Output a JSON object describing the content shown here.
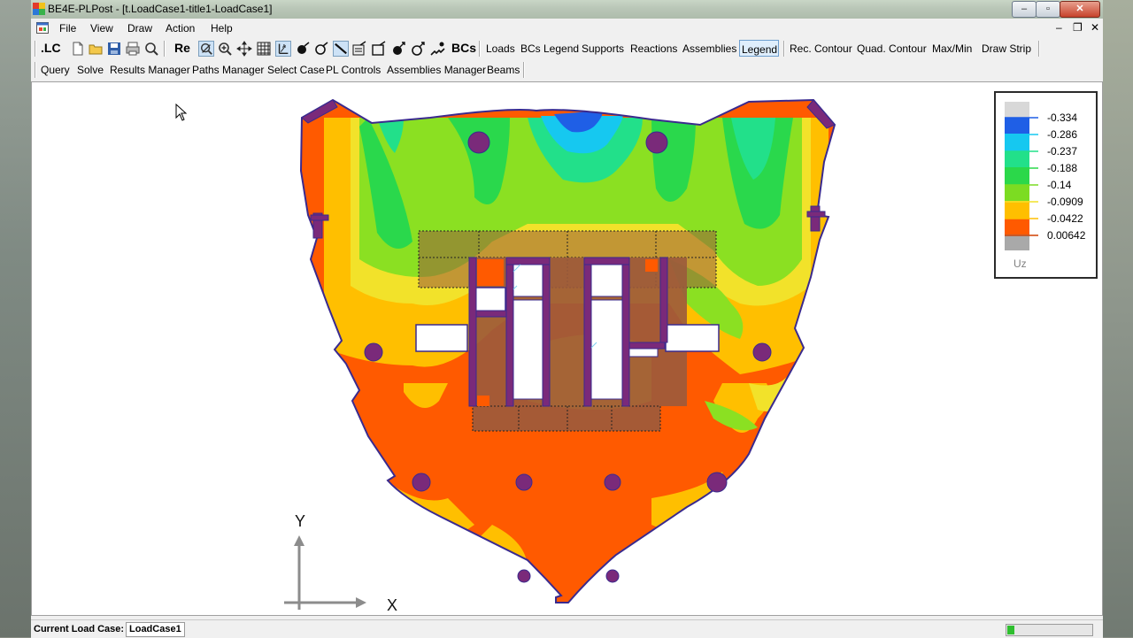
{
  "window": {
    "title": "BE4E-PLPost - [t.LoadCase1-title1-LoadCase1]",
    "controls": {
      "minimize": "–",
      "maximize": "▫",
      "close": "✕"
    }
  },
  "menubar": {
    "items": [
      "File",
      "View",
      "Draw",
      "Action",
      "Help"
    ],
    "mdi_controls": {
      "minimize": "–",
      "restore": "❐",
      "close": "✕"
    }
  },
  "toolbar1": {
    "lc_label": ".LC",
    "re_label": "Re",
    "bcs_label": "BCs",
    "icons": [
      "new-file-icon",
      "open-folder-icon",
      "save-icon",
      "print-icon",
      "zoom-preview-icon",
      "zoom-window-icon",
      "zoom-in-icon",
      "pan-icon",
      "mesh-grid-icon",
      "axes-icon",
      "node-point-icon",
      "node-ring-icon",
      "line-tool-icon",
      "frame-tool-icon",
      "rect-tool-icon",
      "load-point-icon",
      "load-ring-icon",
      "support-spring-icon"
    ],
    "text_buttons": [
      "Loads",
      "BCs Legend",
      "Supports",
      "Reactions",
      "Assemblies"
    ],
    "legend_label": "Legend",
    "right_buttons": [
      "Rec. Contour",
      "Quad. Contour",
      "Max/Min",
      "Draw Strip"
    ]
  },
  "toolbar2": {
    "items": [
      "Query",
      "Solve",
      "Results Manager",
      "Paths Manager",
      "Select Case",
      "PL Controls",
      "Assemblies Manager",
      "Beams"
    ]
  },
  "legend": {
    "entries": [
      {
        "value": "-0.334",
        "color": "#1f5fe6"
      },
      {
        "value": "-0.286",
        "color": "#16c8f0"
      },
      {
        "value": "-0.237",
        "color": "#22e08a"
      },
      {
        "value": "-0.188",
        "color": "#2bd84a"
      },
      {
        "value": "-0.14",
        "color": "#7cdc22"
      },
      {
        "value": "-0.0909",
        "color": "#f2e22a"
      },
      {
        "value": "-0.0422",
        "color": "#ffbf00"
      },
      {
        "value": "0.00642",
        "color": "#ff5a00"
      }
    ],
    "top_color": "#d8d8d8",
    "bottom_color": "#a9a9a9",
    "unit": "Uz"
  },
  "axes": {
    "x_label": "X",
    "y_label": "Y"
  },
  "status": {
    "label": "Current Load Case:",
    "value": "LoadCase1",
    "progress": 0.08
  },
  "colors": {
    "outline": "#3a2a8e",
    "column_fill": "#7a2a7a",
    "core_overlay": "#9b5a3c",
    "orange": "#ff5a00",
    "amber": "#ffbf00",
    "yellow": "#f2e22a",
    "lime": "#8be022",
    "green": "#2ad84c",
    "aqua": "#20e0a0",
    "cyan": "#16c8f0",
    "blue": "#1f5fe6"
  }
}
